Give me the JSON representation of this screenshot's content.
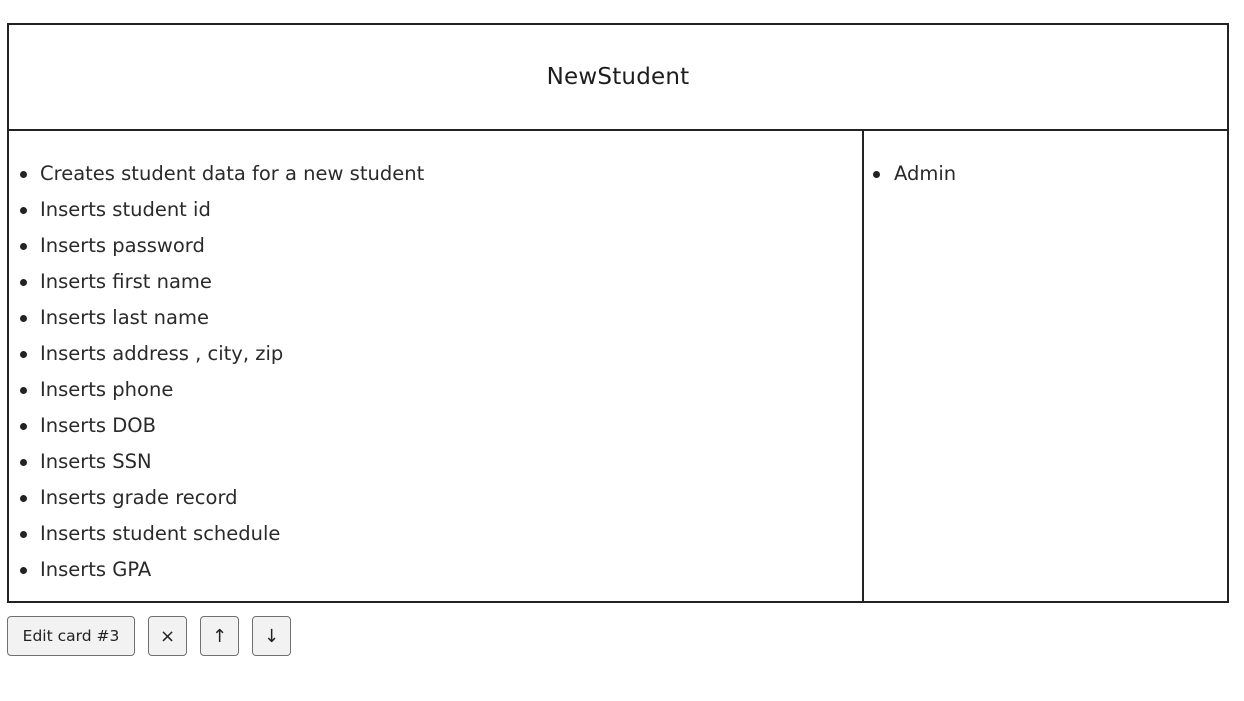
{
  "card": {
    "title": "NewStudent",
    "responsibilities": [
      "Creates student data for a new student",
      "Inserts student id",
      "Inserts password",
      "Inserts first name",
      "Inserts last name",
      "Inserts address , city, zip",
      "Inserts phone",
      "Inserts DOB",
      "Inserts SSN",
      "Inserts grade record",
      "Inserts student schedule",
      "Inserts GPA"
    ],
    "collaborators": [
      "Admin"
    ]
  },
  "controls": {
    "edit_label": "Edit card #3",
    "delete_symbol": "×",
    "move_up_symbol": "↑",
    "move_down_symbol": "↓"
  }
}
